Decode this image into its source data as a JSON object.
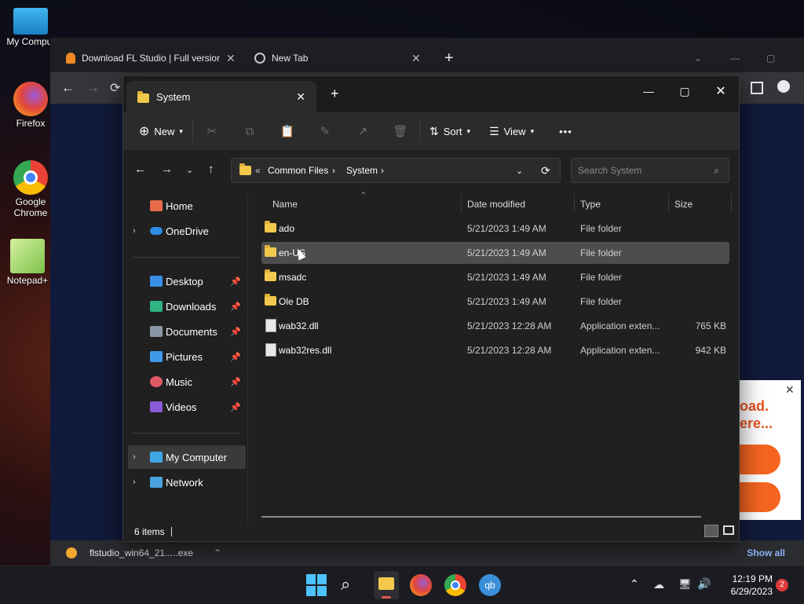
{
  "desktop": {
    "icons": [
      {
        "label": "My Comput"
      },
      {
        "label": "Firefox"
      },
      {
        "label": "Google Chrome"
      },
      {
        "label": "Notepad+"
      }
    ]
  },
  "browser": {
    "tabs": [
      {
        "title": "Download FL Studio | Full version"
      },
      {
        "title": "New Tab"
      }
    ],
    "new_tab": "+",
    "ad_text_1": "oad.",
    "ad_text_2": "ere...",
    "download": {
      "filename": "flstudio_win64_21.....exe",
      "show_all": "Show all"
    }
  },
  "explorer": {
    "tab_title": "System",
    "new_tab": "+",
    "toolbar": {
      "new": "New",
      "sort": "Sort",
      "view": "View",
      "more": "•••"
    },
    "breadcrumb": {
      "prefix": "«",
      "items": [
        "Common Files",
        "System"
      ]
    },
    "search_placeholder": "Search System",
    "sidebar": {
      "home": "Home",
      "onedrive": "OneDrive",
      "quick": [
        {
          "label": "Desktop",
          "color": "#3a8ee6"
        },
        {
          "label": "Downloads",
          "color": "#2fb380"
        },
        {
          "label": "Documents",
          "color": "#8a95a5"
        },
        {
          "label": "Pictures",
          "color": "#3d9be9"
        },
        {
          "label": "Music",
          "color": "#e05a66"
        },
        {
          "label": "Videos",
          "color": "#8a5ad8"
        }
      ],
      "my_computer": "My Computer",
      "network": "Network"
    },
    "columns": {
      "name": "Name",
      "date": "Date modified",
      "type": "Type",
      "size": "Size"
    },
    "files": [
      {
        "name": "ado",
        "date": "5/21/2023 1:49 AM",
        "type": "File folder",
        "size": "",
        "kind": "folder"
      },
      {
        "name": "en-US",
        "date": "5/21/2023 1:49 AM",
        "type": "File folder",
        "size": "",
        "kind": "folder"
      },
      {
        "name": "msadc",
        "date": "5/21/2023 1:49 AM",
        "type": "File folder",
        "size": "",
        "kind": "folder"
      },
      {
        "name": "Ole DB",
        "date": "5/21/2023 1:49 AM",
        "type": "File folder",
        "size": "",
        "kind": "folder"
      },
      {
        "name": "wab32.dll",
        "date": "5/21/2023 12:28 AM",
        "type": "Application exten...",
        "size": "765 KB",
        "kind": "file"
      },
      {
        "name": "wab32res.dll",
        "date": "5/21/2023 12:28 AM",
        "type": "Application exten...",
        "size": "942 KB",
        "kind": "file"
      }
    ],
    "selected_index": 1,
    "status": "6 items"
  },
  "taskbar": {
    "time": "12:19 PM",
    "date": "6/29/2023",
    "notifications": "2"
  }
}
